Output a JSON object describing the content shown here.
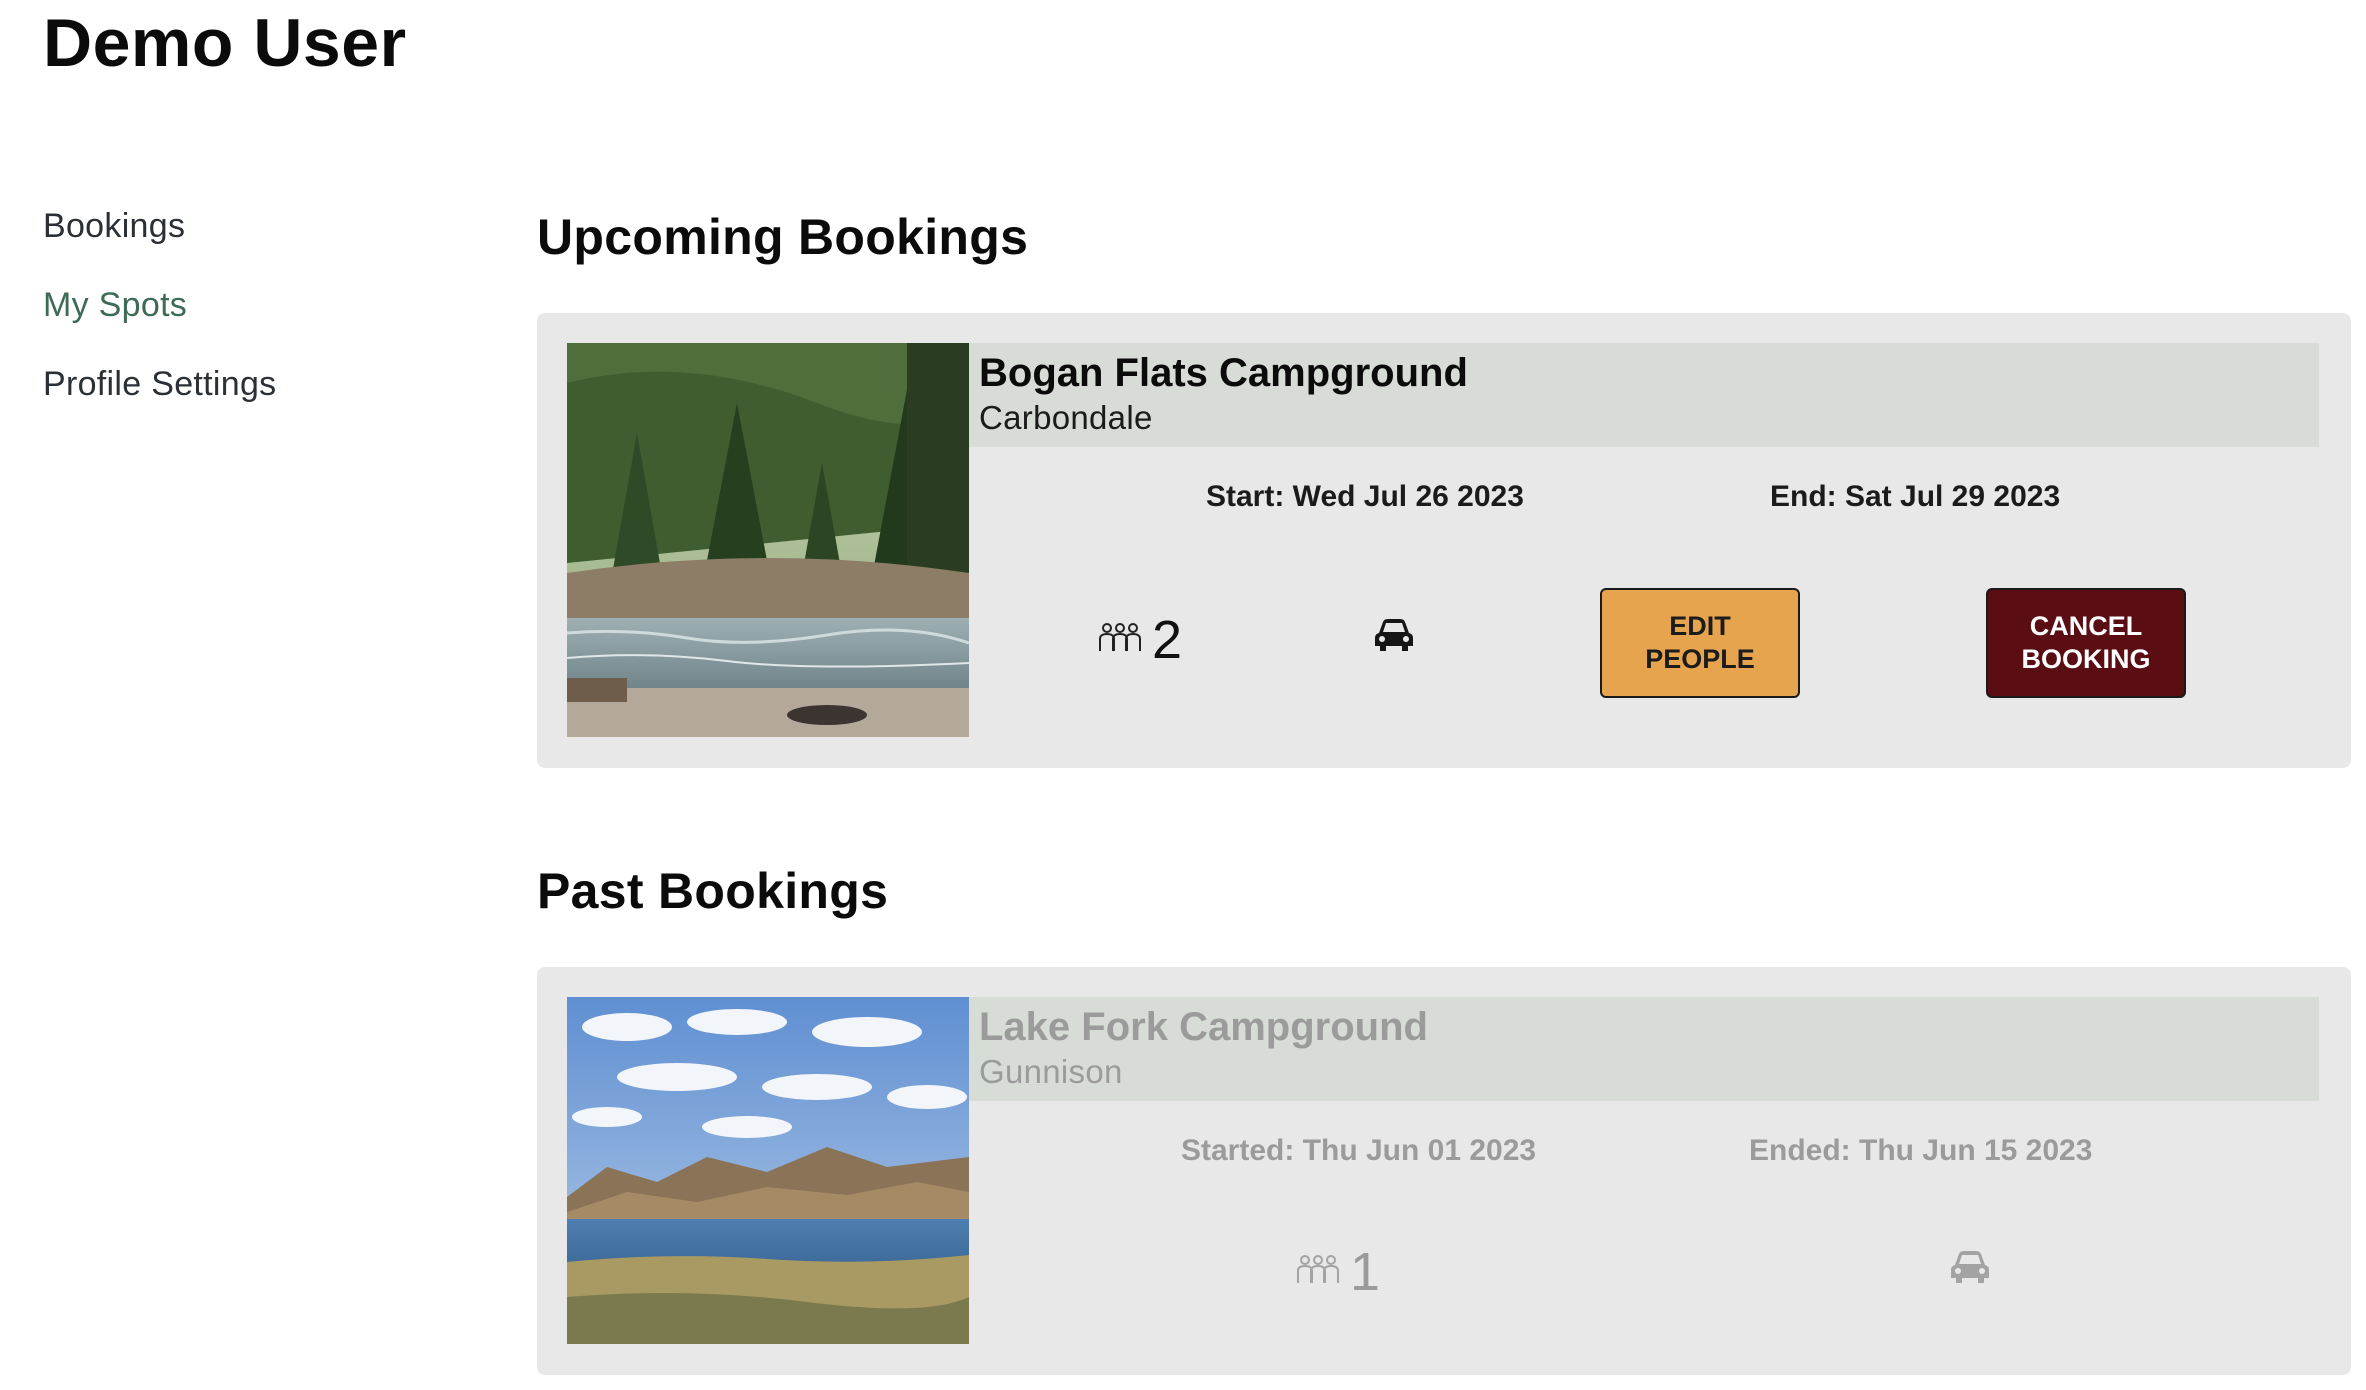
{
  "user": {
    "name": "Demo User"
  },
  "sidebar": {
    "items": [
      {
        "label": "Bookings"
      },
      {
        "label": "My Spots"
      },
      {
        "label": "Profile Settings"
      }
    ]
  },
  "upcoming": {
    "title": "Upcoming Bookings",
    "booking": {
      "name": "Bogan Flats Campground",
      "city": "Carbondale",
      "start": "Start: Wed Jul 26 2023",
      "end": "End: Sat Jul 29 2023",
      "people_count": "2",
      "people_icon": "people-icon",
      "vehicle_icon": "car-icon",
      "edit_label": "EDIT\nPEOPLE",
      "cancel_label": "CANCEL\nBOOKING"
    }
  },
  "past": {
    "title": "Past Bookings",
    "booking": {
      "name": "Lake Fork Campground",
      "city": "Gunnison",
      "start": "Started: Thu Jun 01 2023",
      "end": "Ended: Thu Jun 15 2023",
      "people_count": "1",
      "people_icon": "people-icon",
      "vehicle_icon": "car-icon"
    }
  },
  "colors": {
    "active_nav": "#3d6b55",
    "edit_button": "#e7a44e",
    "cancel_button": "#5a0d12",
    "card_bg": "#e8e8e8",
    "card_header_bg": "#d8dcd7"
  }
}
